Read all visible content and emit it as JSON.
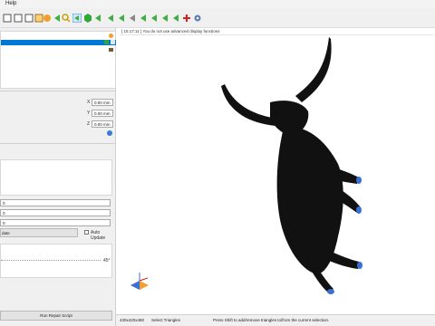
{
  "menubar": {
    "help_label": "Help"
  },
  "toolbar": {
    "icons": [
      "undo-icon",
      "redo-icon",
      "copy-icon",
      "save-icon",
      "orange-circle-icon",
      "green-arrow-icon",
      "search-icon",
      "select-icon",
      "green-hexagon-icon",
      "arrow-icon",
      "green-arrow-icon",
      "green-arrow-icon",
      "gray-arrow-icon",
      "green-arrow-icon",
      "green-arrow-icon",
      "green-arrow-icon",
      "green-arrow-icon",
      "add-icon",
      "settings-icon"
    ]
  },
  "left_panel": {
    "position_fields": [
      "0.00 mm",
      "0.00 mm",
      "0.00 mm"
    ],
    "value_fields": [
      "0",
      "0",
      "0"
    ],
    "update_label": "date",
    "auto_update_label": "Auto Update",
    "angle_label": "45°",
    "run_repair_label": "Run Repair Script"
  },
  "viewport": {
    "notice": "[ 15:17:11 ] You do not use advanced display functions"
  },
  "status": {
    "dimensions": "430x420x480",
    "mode": "Select Triangles",
    "hint": "Press Shift to add/remove triangles to/from the current selection."
  },
  "colors": {
    "selection_blue": "#0078d7",
    "model_fill": "#111111"
  }
}
